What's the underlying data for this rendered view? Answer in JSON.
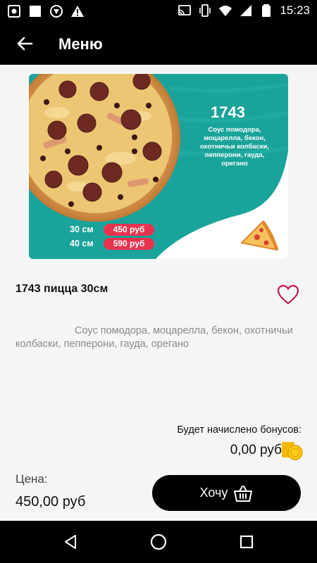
{
  "status_bar": {
    "time": "15:23",
    "left_icons": [
      "screenshot-icon",
      "square-icon",
      "shield-icon",
      "warning-icon"
    ],
    "right_icons": [
      "cast-icon",
      "vibrate-icon",
      "wifi-icon",
      "signal-icon",
      "battery-icon"
    ]
  },
  "header": {
    "title": "Меню"
  },
  "banner": {
    "code": "1743",
    "description": "Соус помодора, моцарелла, бекон, охотничьи колбаски, пепперони, гауда, орегано",
    "sizes": [
      {
        "size": "30 см",
        "price": "450 руб"
      },
      {
        "size": "40 см",
        "price": "590 руб"
      }
    ]
  },
  "product": {
    "name": "1743 пицца 30см",
    "description": "Соус помодора, моцарелла, бекон, охотничьи колбаски, пепперони, гауда, орегано"
  },
  "bonus": {
    "label": "Будет начислено бонусов:",
    "value": "0,00 руб"
  },
  "price": {
    "label": "Цена:",
    "value": "450,00 руб"
  },
  "actions": {
    "want_label": "Хочу"
  },
  "colors": {
    "accent_teal": "#1aa39a",
    "price_pill": "#e8334f",
    "heart": "#c2185b",
    "coin": "#f5b800"
  }
}
